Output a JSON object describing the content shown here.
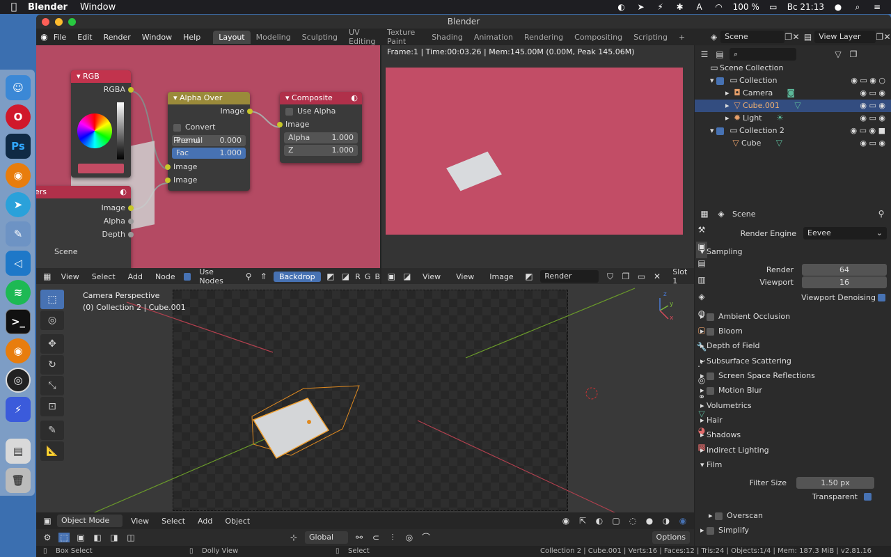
{
  "menubar": {
    "app": "Blender",
    "window": "Window",
    "battery": "100 %",
    "clock": "Вс 21:13"
  },
  "window": {
    "title": "Blender"
  },
  "topbar": {
    "menus": [
      "File",
      "Edit",
      "Render",
      "Window",
      "Help"
    ],
    "tabs": [
      "Layout",
      "Modeling",
      "Sculpting",
      "UV Editing",
      "Texture Paint",
      "Shading",
      "Animation",
      "Rendering",
      "Compositing",
      "Scripting"
    ],
    "scene": "Scene",
    "view_layer": "View Layer"
  },
  "nodes": {
    "rgb": {
      "title": "RGB",
      "out": "RGBA"
    },
    "alpha_over": {
      "title": "Alpha Over",
      "out": "Image",
      "convert": "Convert Premul",
      "premul_label": "Premul",
      "premul_val": "0.000",
      "fac_label": "Fac",
      "fac_val": "1.000",
      "in1": "Image",
      "in2": "Image"
    },
    "composite": {
      "title": "Composite",
      "use_alpha": "Use Alpha",
      "image": "Image",
      "alpha_label": "Alpha",
      "alpha_val": "1.000",
      "z_label": "Z",
      "z_val": "1.000"
    },
    "layers": {
      "title": "ers",
      "image": "Image",
      "alpha": "Alpha",
      "depth": "Depth",
      "scene": "Scene"
    }
  },
  "node_header": {
    "view": "View",
    "select": "Select",
    "add": "Add",
    "node": "Node",
    "use_nodes": "Use Nodes",
    "backdrop": "Backdrop",
    "r": "R",
    "g": "G",
    "b": "B"
  },
  "image_editor": {
    "info": "Frame:1 | Time:00:03.26 | Mem:145.00M (0.00M, Peak 145.06M)",
    "view1": "View",
    "view2": "View",
    "image": "Image",
    "render_result": "Render Result",
    "slot": "Slot 1"
  },
  "outliner": {
    "root": "Scene Collection",
    "items": [
      "Collection",
      "Camera",
      "Cube.001",
      "Light",
      "Collection 2",
      "Cube"
    ]
  },
  "properties": {
    "scene": "Scene",
    "render_engine_label": "Render Engine",
    "render_engine": "Eevee",
    "sampling": "Sampling",
    "render_label": "Render",
    "render_val": "64",
    "viewport_label": "Viewport",
    "viewport_val": "16",
    "viewport_denoising": "Viewport Denoising",
    "panels": [
      "Ambient Occlusion",
      "Bloom",
      "Depth of Field",
      "Subsurface Scattering",
      "Screen Space Reflections",
      "Motion Blur",
      "Volumetrics",
      "Hair",
      "Shadows",
      "Indirect Lighting"
    ],
    "film": "Film",
    "filter_size_label": "Filter Size",
    "filter_size": "1.50 px",
    "transparent": "Transparent",
    "overscan": "Overscan",
    "simplify": "Simplify"
  },
  "viewport": {
    "camera": "Camera Perspective",
    "collection": "(0) Collection 2 | Cube.001",
    "mode": "Object Mode",
    "view": "View",
    "select": "Select",
    "add": "Add",
    "object": "Object",
    "orientation": "Global",
    "options": "Options",
    "axis_z": "z",
    "axis_y": "y",
    "axis_x": "x"
  },
  "statusbar": {
    "box_select": "Box Select",
    "dolly": "Dolly View",
    "select": "Select",
    "info": "Collection 2 | Cube.001 | Verts:16 | Faces:12 | Tris:24 | Objects:1/4 | Mem: 187.3 MiB | v2.81.16"
  }
}
